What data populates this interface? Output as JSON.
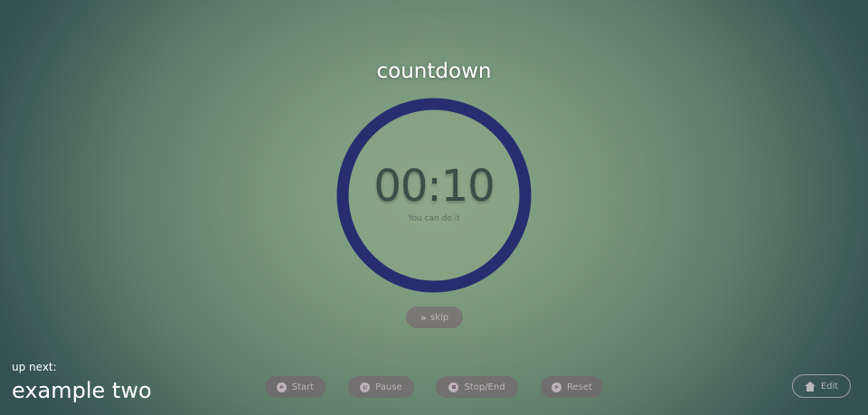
{
  "timer": {
    "title": "countdown",
    "time": "00:10",
    "message": "You can do it",
    "progress": 1.0,
    "ring_color": "#282d70"
  },
  "controls": {
    "skip_label": "skip",
    "start_label": "Start",
    "pause_label": "Pause",
    "stop_label": "Stop/End",
    "reset_label": "Reset"
  },
  "up_next": {
    "label": "up next:",
    "name": "example two"
  },
  "edit": {
    "label": "Edit"
  },
  "icons": [
    "double-chevron-right-icon",
    "play-icon",
    "pause-icon",
    "stop-icon",
    "reset-icon",
    "home-icon"
  ]
}
